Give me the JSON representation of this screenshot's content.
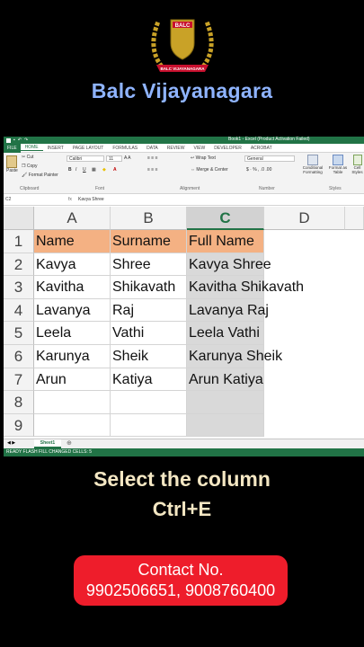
{
  "brand": {
    "logo_text_top": "BALC",
    "logo_text_bottom": "BALC VIJAYANAGARA",
    "name": "Balc Vijayanagara"
  },
  "excel": {
    "title": "Book1 - Excel (Product Activation Failed)",
    "tabs": [
      "FILE",
      "HOME",
      "INSERT",
      "PAGE LAYOUT",
      "FORMULAS",
      "DATA",
      "REVIEW",
      "VIEW",
      "DEVELOPER",
      "ACROBAT"
    ],
    "ribbon": {
      "cut": "Cut",
      "copy": "Copy",
      "paste": "Paste",
      "format_painter": "Format Painter",
      "clipboard": "Clipboard",
      "font_name": "Calibri",
      "font_size": "11",
      "font": "Font",
      "wrap_text": "Wrap Text",
      "merge_center": "Merge & Center",
      "alignment": "Alignment",
      "number_format": "General",
      "number": "Number",
      "conditional_formatting": "Conditional Formatting",
      "format_as_table": "Format as Table",
      "cell_styles": "Cell Styles",
      "styles": "Styles"
    },
    "formula_bar": {
      "name_box": "C2",
      "fx": "fx",
      "value": "Kavya Shree"
    },
    "columns": [
      "A",
      "B",
      "C",
      "D"
    ],
    "rows": [
      "1",
      "2",
      "3",
      "4",
      "5",
      "6",
      "7",
      "8",
      "9"
    ],
    "cells": [
      [
        "Name",
        "Surname",
        "Full Name"
      ],
      [
        "Kavya",
        "Shree",
        "Kavya Shree"
      ],
      [
        "Kavitha",
        "Shikavath",
        "Kavitha Shikavath"
      ],
      [
        "Lavanya",
        "Raj",
        "Lavanya Raj"
      ],
      [
        "Leela",
        "Vathi",
        "Leela Vathi"
      ],
      [
        "Karunya",
        "Sheik",
        "Karunya Sheik"
      ],
      [
        "Arun",
        "Katiya",
        "Arun Katiya"
      ]
    ],
    "sheet_tab": "Sheet1",
    "status": "READY   FLASH FILL CHANGED CELLS: 5"
  },
  "captions": {
    "line1": "Select the column",
    "line2": "Ctrl+E"
  },
  "contact": {
    "label": "Contact No.",
    "numbers": "9902506651, 9008760400"
  },
  "colors": {
    "excel_green": "#217346",
    "header_fill": "#f4b183",
    "contact_bg": "#ee1d2b",
    "brand_text": "#8fb4ff"
  }
}
